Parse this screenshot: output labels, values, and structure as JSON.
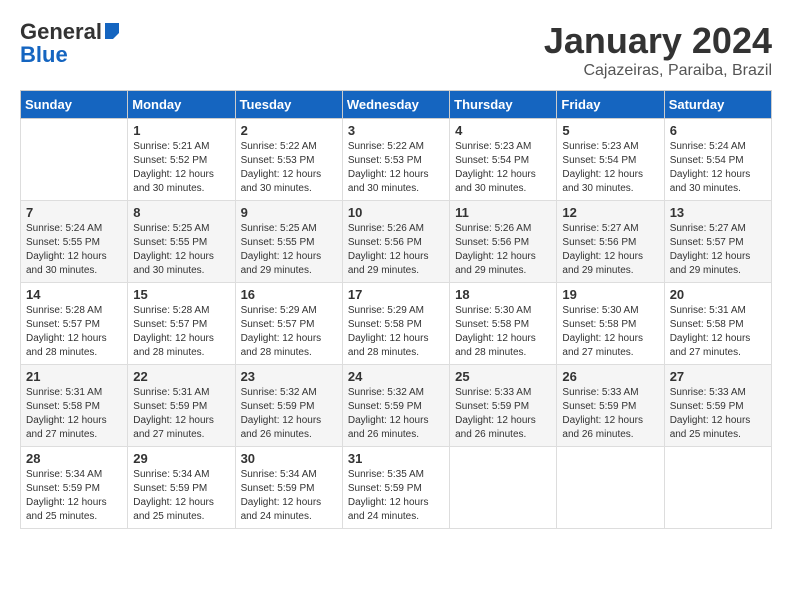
{
  "header": {
    "logo_line1": "General",
    "logo_line2": "Blue",
    "title": "January 2024",
    "subtitle": "Cajazeiras, Paraiba, Brazil"
  },
  "weekdays": [
    "Sunday",
    "Monday",
    "Tuesday",
    "Wednesday",
    "Thursday",
    "Friday",
    "Saturday"
  ],
  "weeks": [
    [
      {
        "day": "",
        "info": ""
      },
      {
        "day": "1",
        "info": "Sunrise: 5:21 AM\nSunset: 5:52 PM\nDaylight: 12 hours\nand 30 minutes."
      },
      {
        "day": "2",
        "info": "Sunrise: 5:22 AM\nSunset: 5:53 PM\nDaylight: 12 hours\nand 30 minutes."
      },
      {
        "day": "3",
        "info": "Sunrise: 5:22 AM\nSunset: 5:53 PM\nDaylight: 12 hours\nand 30 minutes."
      },
      {
        "day": "4",
        "info": "Sunrise: 5:23 AM\nSunset: 5:54 PM\nDaylight: 12 hours\nand 30 minutes."
      },
      {
        "day": "5",
        "info": "Sunrise: 5:23 AM\nSunset: 5:54 PM\nDaylight: 12 hours\nand 30 minutes."
      },
      {
        "day": "6",
        "info": "Sunrise: 5:24 AM\nSunset: 5:54 PM\nDaylight: 12 hours\nand 30 minutes."
      }
    ],
    [
      {
        "day": "7",
        "info": "Sunrise: 5:24 AM\nSunset: 5:55 PM\nDaylight: 12 hours\nand 30 minutes."
      },
      {
        "day": "8",
        "info": "Sunrise: 5:25 AM\nSunset: 5:55 PM\nDaylight: 12 hours\nand 30 minutes."
      },
      {
        "day": "9",
        "info": "Sunrise: 5:25 AM\nSunset: 5:55 PM\nDaylight: 12 hours\nand 29 minutes."
      },
      {
        "day": "10",
        "info": "Sunrise: 5:26 AM\nSunset: 5:56 PM\nDaylight: 12 hours\nand 29 minutes."
      },
      {
        "day": "11",
        "info": "Sunrise: 5:26 AM\nSunset: 5:56 PM\nDaylight: 12 hours\nand 29 minutes."
      },
      {
        "day": "12",
        "info": "Sunrise: 5:27 AM\nSunset: 5:56 PM\nDaylight: 12 hours\nand 29 minutes."
      },
      {
        "day": "13",
        "info": "Sunrise: 5:27 AM\nSunset: 5:57 PM\nDaylight: 12 hours\nand 29 minutes."
      }
    ],
    [
      {
        "day": "14",
        "info": "Sunrise: 5:28 AM\nSunset: 5:57 PM\nDaylight: 12 hours\nand 28 minutes."
      },
      {
        "day": "15",
        "info": "Sunrise: 5:28 AM\nSunset: 5:57 PM\nDaylight: 12 hours\nand 28 minutes."
      },
      {
        "day": "16",
        "info": "Sunrise: 5:29 AM\nSunset: 5:57 PM\nDaylight: 12 hours\nand 28 minutes."
      },
      {
        "day": "17",
        "info": "Sunrise: 5:29 AM\nSunset: 5:58 PM\nDaylight: 12 hours\nand 28 minutes."
      },
      {
        "day": "18",
        "info": "Sunrise: 5:30 AM\nSunset: 5:58 PM\nDaylight: 12 hours\nand 28 minutes."
      },
      {
        "day": "19",
        "info": "Sunrise: 5:30 AM\nSunset: 5:58 PM\nDaylight: 12 hours\nand 27 minutes."
      },
      {
        "day": "20",
        "info": "Sunrise: 5:31 AM\nSunset: 5:58 PM\nDaylight: 12 hours\nand 27 minutes."
      }
    ],
    [
      {
        "day": "21",
        "info": "Sunrise: 5:31 AM\nSunset: 5:58 PM\nDaylight: 12 hours\nand 27 minutes."
      },
      {
        "day": "22",
        "info": "Sunrise: 5:31 AM\nSunset: 5:59 PM\nDaylight: 12 hours\nand 27 minutes."
      },
      {
        "day": "23",
        "info": "Sunrise: 5:32 AM\nSunset: 5:59 PM\nDaylight: 12 hours\nand 26 minutes."
      },
      {
        "day": "24",
        "info": "Sunrise: 5:32 AM\nSunset: 5:59 PM\nDaylight: 12 hours\nand 26 minutes."
      },
      {
        "day": "25",
        "info": "Sunrise: 5:33 AM\nSunset: 5:59 PM\nDaylight: 12 hours\nand 26 minutes."
      },
      {
        "day": "26",
        "info": "Sunrise: 5:33 AM\nSunset: 5:59 PM\nDaylight: 12 hours\nand 26 minutes."
      },
      {
        "day": "27",
        "info": "Sunrise: 5:33 AM\nSunset: 5:59 PM\nDaylight: 12 hours\nand 25 minutes."
      }
    ],
    [
      {
        "day": "28",
        "info": "Sunrise: 5:34 AM\nSunset: 5:59 PM\nDaylight: 12 hours\nand 25 minutes."
      },
      {
        "day": "29",
        "info": "Sunrise: 5:34 AM\nSunset: 5:59 PM\nDaylight: 12 hours\nand 25 minutes."
      },
      {
        "day": "30",
        "info": "Sunrise: 5:34 AM\nSunset: 5:59 PM\nDaylight: 12 hours\nand 24 minutes."
      },
      {
        "day": "31",
        "info": "Sunrise: 5:35 AM\nSunset: 5:59 PM\nDaylight: 12 hours\nand 24 minutes."
      },
      {
        "day": "",
        "info": ""
      },
      {
        "day": "",
        "info": ""
      },
      {
        "day": "",
        "info": ""
      }
    ]
  ]
}
